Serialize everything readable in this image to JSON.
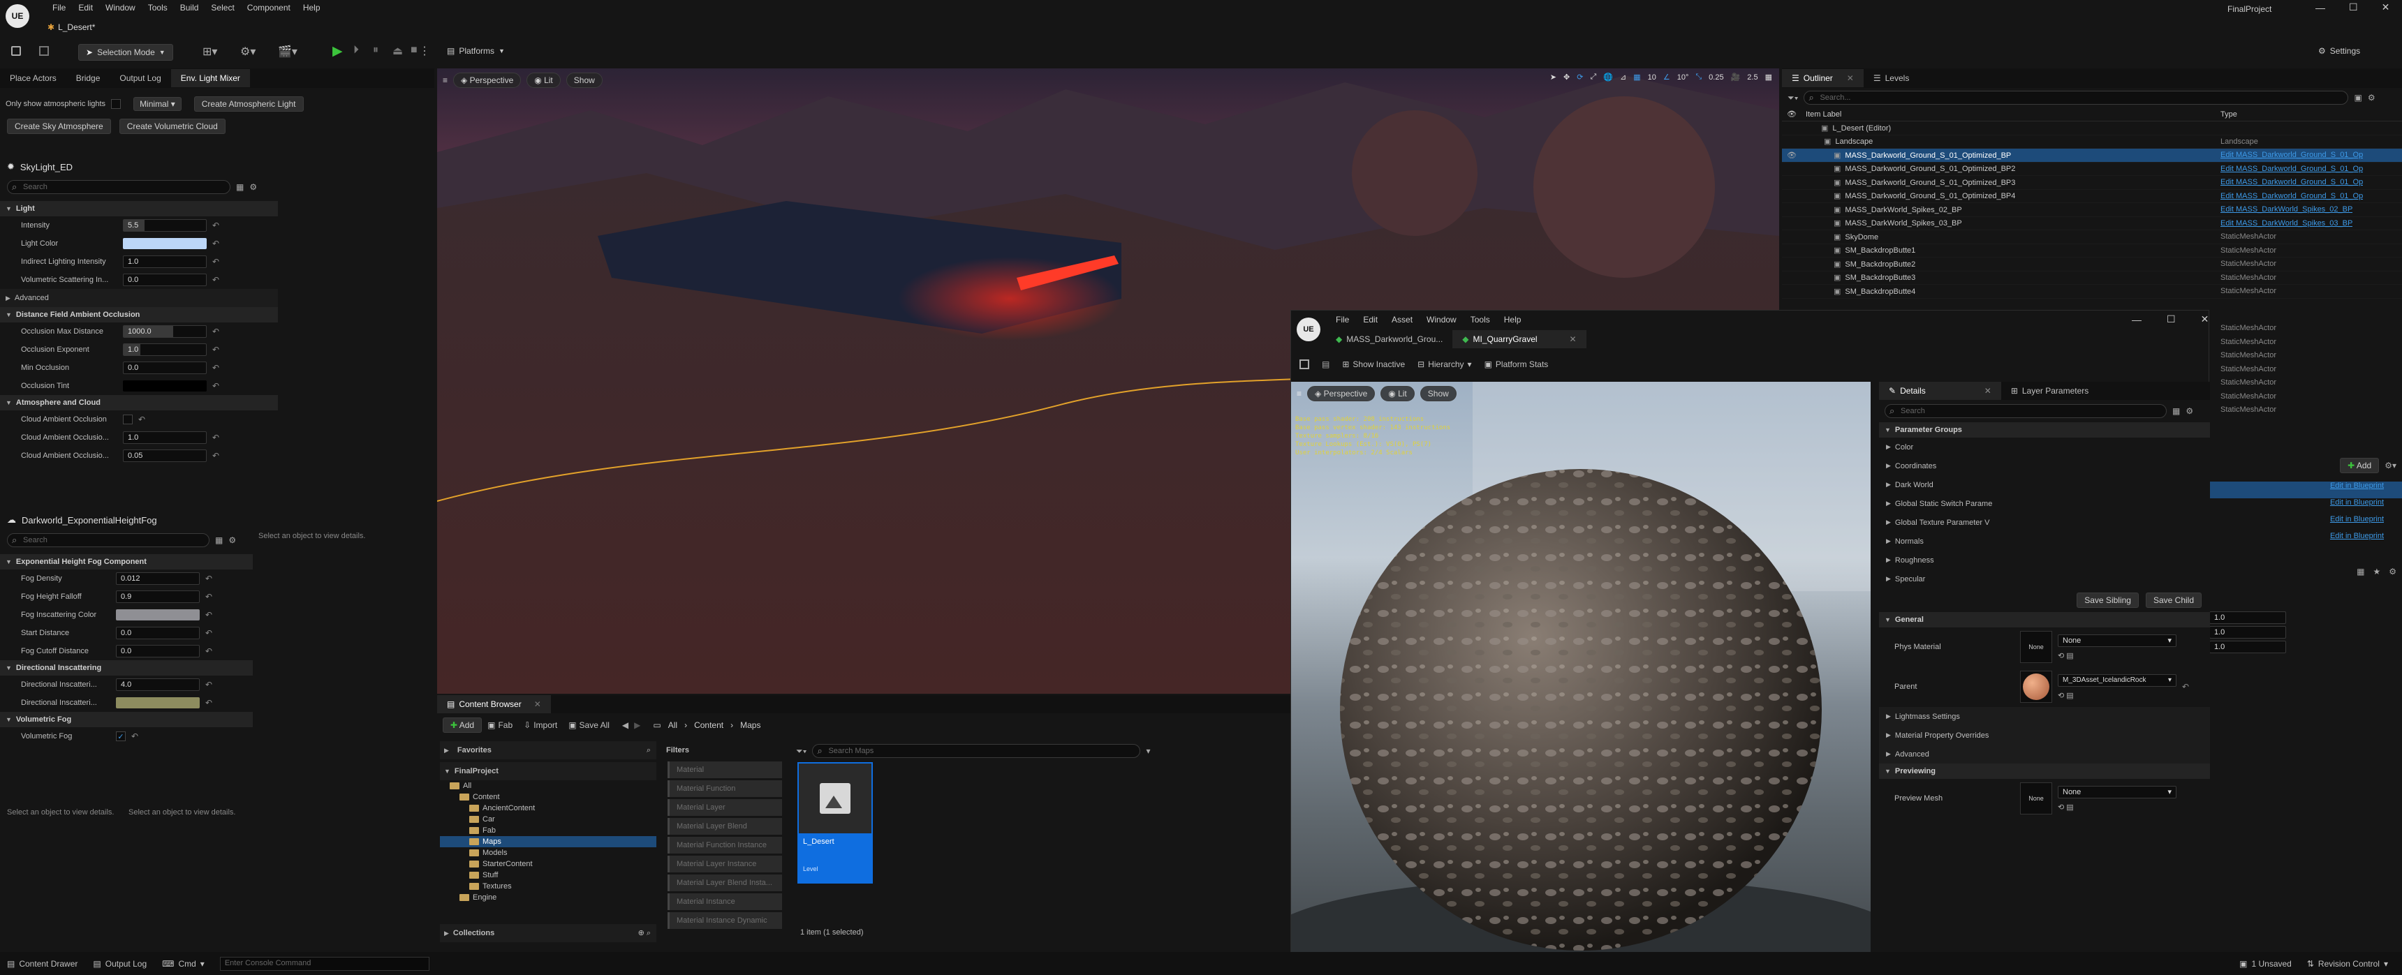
{
  "menubar": {
    "logo": "UE",
    "items": [
      "File",
      "Edit",
      "Window",
      "Tools",
      "Build",
      "Select",
      "Component",
      "Help"
    ],
    "project": "FinalProject"
  },
  "level_tab": "L_Desert*",
  "toolbar": {
    "mode": "Selection Mode",
    "platforms": "Platforms",
    "settings": "Settings"
  },
  "left": {
    "tabs": [
      "Place Actors",
      "Bridge",
      "Output Log",
      "Env. Light Mixer"
    ],
    "only_show": "Only show atmospheric lights",
    "minimal": "Minimal",
    "buttons": [
      "Create Atmospheric Light",
      "Create Sky Atmosphere",
      "Create Volumetric Cloud"
    ],
    "skylight": {
      "title": "SkyLight_ED",
      "search": "Search",
      "light_cat": "Light",
      "props": [
        {
          "label": "Intensity",
          "value": "5.5",
          "fill": 0.25
        },
        {
          "label": "Light Color",
          "swatch": "#bcd6f7"
        },
        {
          "label": "Indirect Lighting Intensity",
          "value": "1.0",
          "fill": 0
        },
        {
          "label": "Volumetric Scattering In...",
          "value": "0.0",
          "fill": 0
        }
      ],
      "advanced": "Advanced",
      "dfao_cat": "Distance Field Ambient Occlusion",
      "dfao": [
        {
          "label": "Occlusion Max Distance",
          "value": "1000.0",
          "fill": 0.6
        },
        {
          "label": "Occlusion Exponent",
          "value": "1.0",
          "fill": 0.2
        },
        {
          "label": "Min Occlusion",
          "value": "0.0",
          "fill": 0
        },
        {
          "label": "Occlusion Tint",
          "swatch": "#000000"
        }
      ],
      "atm_cat": "Atmosphere and Cloud",
      "atm": [
        {
          "label": "Cloud Ambient Occlusion",
          "value": ""
        },
        {
          "label": "Cloud Ambient Occlusio...",
          "value": "1.0"
        },
        {
          "label": "Cloud Ambient Occlusio...",
          "value": "0.05"
        }
      ]
    },
    "fog": {
      "title": "Darkworld_ExponentialHeightFog",
      "search": "Search",
      "hint": "Select an object to view details.",
      "cat": "Exponential Height Fog Component",
      "props": [
        {
          "label": "Fog Density",
          "value": "0.012"
        },
        {
          "label": "Fog Height Falloff",
          "value": "0.9"
        },
        {
          "label": "Fog Inscattering Color",
          "swatch": "#8f8f94"
        },
        {
          "label": "Start Distance",
          "value": "0.0"
        },
        {
          "label": "Fog Cutoff Distance",
          "value": "0.0"
        }
      ],
      "dir_cat": "Directional Inscattering",
      "dir": [
        {
          "label": "Directional Inscatteri...",
          "value": "4.0"
        },
        {
          "label": "Directional Inscatteri...",
          "swatch": "#8d8c5f"
        }
      ],
      "vol_cat": "Volumetric Fog",
      "vol": [
        {
          "label": "Volumetric Fog",
          "value": "✓"
        }
      ]
    },
    "hint1": "Select an object to view details.",
    "hint2": "Select an object to view details."
  },
  "viewport": {
    "perspective": "Perspective",
    "lit": "Lit",
    "show": "Show",
    "snap1": "10",
    "snap2": "10°",
    "snap3": "0.25",
    "snap4": "2.5"
  },
  "outliner": {
    "tab": "Outliner",
    "tab2": "Levels",
    "search": "Search...",
    "col1": "Item Label",
    "col2": "Type",
    "rows": [
      {
        "label": "L_Desert (Editor)",
        "type": ""
      },
      {
        "label": "Landscape",
        "type": "Landscape"
      },
      {
        "label": "MASS_Darkworld_Ground_S_01_Optimized_BP",
        "type": "Edit MASS_Darkworld_Ground_S_01_Op",
        "link": true,
        "sel": true
      },
      {
        "label": "MASS_Darkworld_Ground_S_01_Optimized_BP2",
        "type": "Edit MASS_Darkworld_Ground_S_01_Op",
        "link": true
      },
      {
        "label": "MASS_Darkworld_Ground_S_01_Optimized_BP3",
        "type": "Edit MASS_Darkworld_Ground_S_01_Op",
        "link": true
      },
      {
        "label": "MASS_Darkworld_Ground_S_01_Optimized_BP4",
        "type": "Edit MASS_Darkworld_Ground_S_01_Op",
        "link": true
      },
      {
        "label": "MASS_DarkWorld_Spikes_02_BP",
        "type": "Edit MASS_DarkWorld_Spikes_02_BP",
        "link": true
      },
      {
        "label": "MASS_DarkWorld_Spikes_03_BP",
        "type": "Edit MASS_DarkWorld_Spikes_03_BP",
        "link": true
      },
      {
        "label": "SkyDome",
        "type": "StaticMeshActor"
      },
      {
        "label": "SM_BackdropButte1",
        "type": "StaticMeshActor"
      },
      {
        "label": "SM_BackdropButte2",
        "type": "StaticMeshActor"
      },
      {
        "label": "SM_BackdropButte3",
        "type": "StaticMeshActor"
      },
      {
        "label": "SM_BackdropButte4",
        "type": "StaticMeshActor"
      }
    ],
    "more_types": [
      "StaticMeshActor",
      "StaticMeshActor",
      "StaticMeshActor",
      "StaticMeshActor",
      "StaticMeshActor",
      "StaticMeshActor",
      "StaticMeshActor"
    ]
  },
  "rightdetails": {
    "add": "Add",
    "links": [
      "Edit in Blueprint",
      "Edit in Blueprint",
      "Edit in Blueprint",
      "Edit in Blueprint"
    ],
    "values": [
      "1.0",
      "1.0",
      "1.0"
    ]
  },
  "content": {
    "tab": "Content Browser",
    "add": "Add",
    "fab": "Fab",
    "import": "Import",
    "saveall": "Save All",
    "crumbs": [
      "All",
      "Content",
      "Maps"
    ],
    "favorites": "Favorites",
    "project": "FinalProject",
    "tree": [
      {
        "l": "All",
        "d": 0
      },
      {
        "l": "Content",
        "d": 1
      },
      {
        "l": "AncientContent",
        "d": 2
      },
      {
        "l": "Car",
        "d": 2
      },
      {
        "l": "Fab",
        "d": 2
      },
      {
        "l": "Maps",
        "d": 2,
        "sel": true
      },
      {
        "l": "Models",
        "d": 2
      },
      {
        "l": "StarterContent",
        "d": 2
      },
      {
        "l": "Stuff",
        "d": 2
      },
      {
        "l": "Textures",
        "d": 2
      },
      {
        "l": "Engine",
        "d": 1
      }
    ],
    "collections": "Collections",
    "filters": "Filters",
    "filterlist": [
      "Material",
      "Material Function",
      "Material Layer",
      "Material Layer Blend",
      "Material Function Instance",
      "Material Layer Instance",
      "Material Layer Blend Insta...",
      "Material Instance",
      "Material Instance Dynamic"
    ],
    "search": "Search Maps",
    "asset": "L_Desert",
    "asset_type": "Level",
    "count": "1 item (1 selected)"
  },
  "mi": {
    "menu": [
      "File",
      "Edit",
      "Asset",
      "Window",
      "Tools",
      "Help"
    ],
    "tab1": "MASS_Darkworld_Grou...",
    "tab2": "MI_QuarryGravel",
    "toolbar": [
      "Show Inactive",
      "Hierarchy",
      "Platform Stats"
    ],
    "vp": {
      "perspective": "Perspective",
      "lit": "Lit",
      "show": "Show"
    },
    "stats": [
      "Base pass shader: 208 instructions",
      "Base pass vertex shader: 143 instructions",
      "Texture samplers: 8/16",
      "Texture Lookups (Est.): VS(0), PS(7)",
      "User interpolators: 2/4 Scalars"
    ],
    "details_tab": "Details",
    "layer_tab": "Layer Parameters",
    "search": "Search",
    "groups_title": "Parameter Groups",
    "groups": [
      "Color",
      "Coordinates",
      "Dark World",
      "Global Static Switch Parame",
      "Global Texture Parameter V",
      "Normals",
      "Roughness",
      "Specular"
    ],
    "save_sibling": "Save Sibling",
    "save_child": "Save Child",
    "general": "General",
    "phys": "Phys Material",
    "phys_val": "None",
    "none": "None",
    "parent": "Parent",
    "parent_val": "M_3DAsset_IcelandicRock",
    "sections": [
      "Lightmass Settings",
      "Material Property Overrides",
      "Advanced"
    ],
    "previewing": "Previewing",
    "preview_mesh": "Preview Mesh",
    "preview_val": "None"
  },
  "statusbar": {
    "drawer": "Content Drawer",
    "output": "Output Log",
    "cmd": "Cmd",
    "console": "Enter Console Command",
    "unsaved": "1 Unsaved",
    "revision": "Revision Control"
  }
}
